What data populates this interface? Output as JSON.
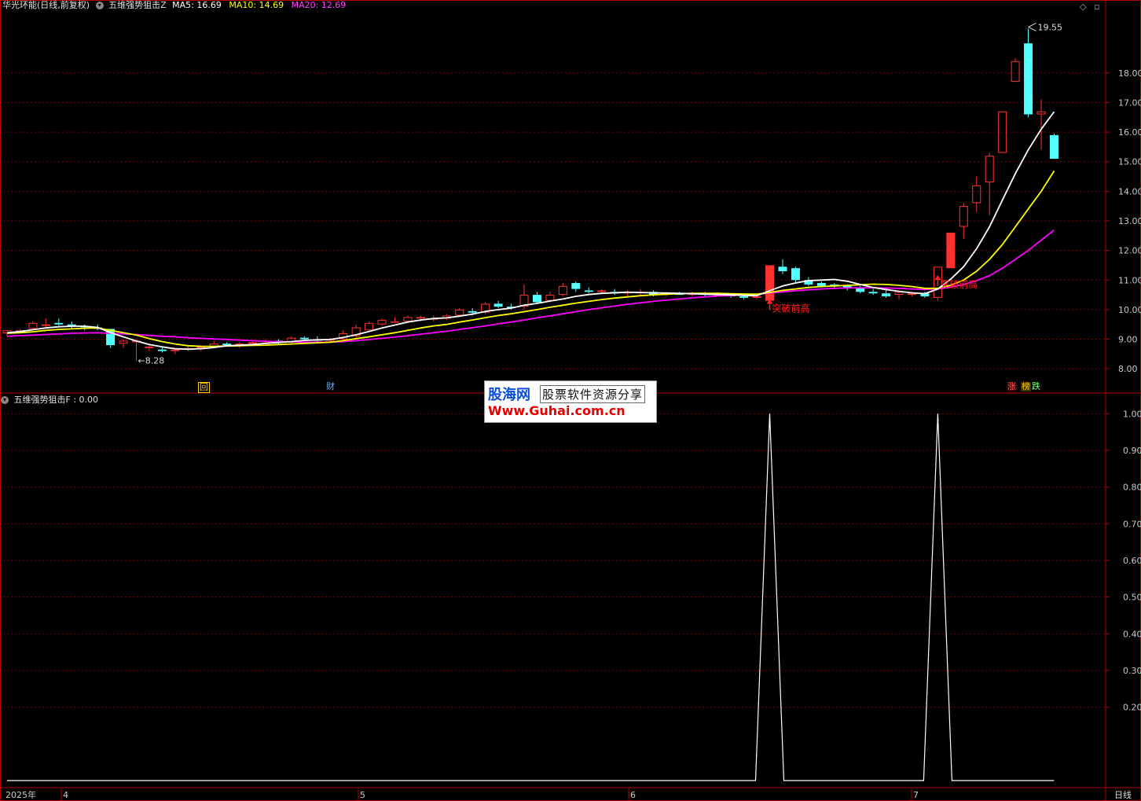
{
  "header": {
    "stock_title": "华光环能(日线,前复权)",
    "indicator_name": "五维强势狙击Z",
    "ma5_label": "MA5: 16.69",
    "ma10_label": "MA10: 14.69",
    "ma20_label": "MA20: 12.69",
    "corner_icons": [
      "diamond-icon",
      "window-icon"
    ]
  },
  "sub_header": {
    "indicator_label": "五维强势狙击F : 0.00"
  },
  "colors": {
    "background": "#000000",
    "grid": "#7a0000",
    "frame": "#b40000",
    "up_candle": "#ff3232",
    "down_candle": "#54ffff",
    "ma5": "#ffffff",
    "ma10": "#ffff00",
    "ma20": "#ff00ff",
    "annotation": "#ff2020",
    "signal_line": "#ffffff"
  },
  "markers": [
    {
      "id": "hui",
      "text": "回",
      "color": "#ffcc00"
    },
    {
      "id": "cai",
      "text": "财",
      "color": "#5fb0ff"
    },
    {
      "id": "zhang",
      "text": "涨",
      "color": "#ff6060"
    },
    {
      "id": "bang",
      "text": "榜",
      "color": "#ffcc00"
    },
    {
      "id": "die",
      "text": "跌",
      "color": "#7cff7c"
    }
  ],
  "watermark": {
    "line1_logo": "股海网",
    "line1_slogan": "股票软件资源分享",
    "line2": "Www.Guhai.com.cn"
  },
  "period_label": "日线",
  "chart_data": [
    {
      "type": "candlestick",
      "panel": "price",
      "ylim": [
        7.5,
        20.2
      ],
      "y_ticks": [
        "18.00",
        "17.00",
        "16.00",
        "15.00",
        "14.00",
        "13.00",
        "12.00",
        "11.00",
        "10.00",
        "9.00",
        "8.00"
      ],
      "x_axis": [
        "2025年",
        "4",
        "5",
        "6",
        "7"
      ],
      "candles": [
        [
          9.2,
          9.3,
          9.1,
          9.3
        ],
        [
          9.25,
          9.35,
          9.2,
          9.3
        ],
        [
          9.35,
          9.6,
          9.3,
          9.55
        ],
        [
          9.45,
          9.7,
          9.4,
          9.5
        ],
        [
          9.55,
          9.7,
          9.45,
          9.5
        ],
        [
          9.5,
          9.6,
          9.35,
          9.45
        ],
        [
          9.45,
          9.5,
          9.3,
          9.4
        ],
        [
          9.4,
          9.5,
          9.3,
          9.35
        ],
        [
          9.35,
          9.35,
          8.7,
          8.8
        ],
        [
          8.85,
          9.0,
          8.7,
          8.95
        ],
        [
          8.9,
          9.0,
          8.28,
          8.95
        ],
        [
          8.7,
          8.8,
          8.6,
          8.75
        ],
        [
          8.65,
          8.75,
          8.55,
          8.6
        ],
        [
          8.6,
          8.7,
          8.5,
          8.65
        ],
        [
          8.65,
          8.75,
          8.6,
          8.7
        ],
        [
          8.7,
          8.8,
          8.6,
          8.75
        ],
        [
          8.75,
          8.95,
          8.7,
          8.85
        ],
        [
          8.85,
          8.9,
          8.75,
          8.8
        ],
        [
          8.8,
          8.9,
          8.7,
          8.85
        ],
        [
          8.85,
          8.95,
          8.8,
          8.9
        ],
        [
          8.9,
          9.0,
          8.85,
          8.95
        ],
        [
          8.95,
          9.0,
          8.85,
          8.9
        ],
        [
          8.9,
          9.1,
          8.85,
          9.05
        ],
        [
          9.05,
          9.1,
          8.95,
          9.0
        ],
        [
          9.0,
          9.1,
          8.9,
          8.95
        ],
        [
          8.95,
          9.05,
          8.9,
          9.0
        ],
        [
          9.0,
          9.3,
          8.95,
          9.2
        ],
        [
          9.1,
          9.5,
          9.0,
          9.4
        ],
        [
          9.3,
          9.6,
          9.25,
          9.55
        ],
        [
          9.5,
          9.7,
          9.45,
          9.65
        ],
        [
          9.6,
          9.75,
          9.55,
          9.6
        ],
        [
          9.6,
          9.8,
          9.55,
          9.75
        ],
        [
          9.7,
          9.8,
          9.6,
          9.75
        ],
        [
          9.7,
          9.8,
          9.6,
          9.7
        ],
        [
          9.7,
          9.85,
          9.65,
          9.8
        ],
        [
          9.8,
          10.05,
          9.75,
          10.0
        ],
        [
          9.95,
          10.05,
          9.8,
          9.9
        ],
        [
          9.9,
          10.25,
          9.85,
          10.2
        ],
        [
          10.2,
          10.3,
          10.05,
          10.1
        ],
        [
          10.1,
          10.2,
          10.0,
          10.05
        ],
        [
          10.1,
          10.85,
          10.0,
          10.5
        ],
        [
          10.5,
          10.6,
          10.2,
          10.25
        ],
        [
          10.3,
          10.6,
          10.25,
          10.5
        ],
        [
          10.5,
          10.9,
          10.45,
          10.8
        ],
        [
          10.9,
          10.95,
          10.6,
          10.7
        ],
        [
          10.65,
          10.75,
          10.55,
          10.6
        ],
        [
          10.6,
          10.7,
          10.55,
          10.65
        ],
        [
          10.6,
          10.7,
          10.5,
          10.55
        ],
        [
          10.55,
          10.65,
          10.45,
          10.6
        ],
        [
          10.55,
          10.7,
          10.5,
          10.6
        ],
        [
          10.6,
          10.65,
          10.45,
          10.5
        ],
        [
          10.5,
          10.6,
          10.45,
          10.55
        ],
        [
          10.55,
          10.6,
          10.5,
          10.5
        ],
        [
          10.5,
          10.6,
          10.45,
          10.55
        ],
        [
          10.55,
          10.6,
          10.45,
          10.5
        ],
        [
          10.5,
          10.6,
          10.45,
          10.5
        ],
        [
          10.5,
          10.55,
          10.4,
          10.45
        ],
        [
          10.45,
          10.5,
          10.35,
          10.4
        ],
        [
          10.4,
          10.5,
          10.35,
          10.45
        ],
        [
          10.3,
          11.5,
          10.25,
          11.5
        ],
        [
          11.45,
          11.7,
          11.2,
          11.3
        ],
        [
          11.4,
          11.45,
          10.9,
          11.0
        ],
        [
          11.0,
          11.1,
          10.8,
          10.85
        ],
        [
          10.9,
          10.95,
          10.75,
          10.8
        ],
        [
          10.85,
          10.9,
          10.7,
          10.8
        ],
        [
          10.8,
          10.85,
          10.65,
          10.75
        ],
        [
          10.75,
          10.8,
          10.55,
          10.6
        ],
        [
          10.6,
          10.7,
          10.5,
          10.55
        ],
        [
          10.55,
          10.7,
          10.4,
          10.45
        ],
        [
          10.5,
          10.65,
          10.35,
          10.6
        ],
        [
          10.5,
          10.6,
          10.45,
          10.55
        ],
        [
          10.55,
          10.6,
          10.4,
          10.45
        ],
        [
          10.4,
          11.45,
          10.3,
          11.45
        ],
        [
          11.4,
          12.6,
          11.4,
          12.6
        ],
        [
          12.8,
          13.6,
          12.4,
          13.5
        ],
        [
          13.6,
          14.5,
          13.3,
          14.2
        ],
        [
          14.3,
          15.3,
          13.2,
          15.2
        ],
        [
          15.3,
          16.7,
          15.3,
          16.7
        ],
        [
          17.7,
          18.5,
          17.7,
          18.4
        ],
        [
          19.0,
          19.5,
          16.5,
          16.6
        ],
        [
          16.6,
          17.1,
          15.4,
          16.7
        ],
        [
          15.9,
          15.95,
          15.1,
          15.1
        ]
      ],
      "ma5": [
        9.22,
        9.26,
        9.32,
        9.38,
        9.42,
        9.44,
        9.44,
        9.4,
        9.22,
        9.08,
        8.94,
        8.82,
        8.74,
        8.68,
        8.66,
        8.68,
        8.72,
        8.78,
        8.8,
        8.82,
        8.86,
        8.89,
        8.92,
        8.96,
        8.98,
        8.99,
        9.06,
        9.15,
        9.26,
        9.38,
        9.48,
        9.58,
        9.65,
        9.7,
        9.72,
        9.78,
        9.85,
        9.94,
        10.0,
        10.05,
        10.15,
        10.21,
        10.29,
        10.36,
        10.45,
        10.51,
        10.55,
        10.57,
        10.59,
        10.58,
        10.57,
        10.56,
        10.55,
        10.54,
        10.52,
        10.51,
        10.5,
        10.48,
        10.47,
        10.64,
        10.8,
        10.9,
        10.98,
        11.0,
        11.02,
        10.96,
        10.85,
        10.75,
        10.68,
        10.62,
        10.57,
        10.54,
        10.7,
        11.03,
        11.45,
        12.06,
        12.8,
        13.7,
        14.6,
        15.4,
        16.1,
        16.69
      ],
      "ma10": [
        9.2,
        9.22,
        9.25,
        9.3,
        9.33,
        9.35,
        9.37,
        9.38,
        9.3,
        9.22,
        9.14,
        9.02,
        8.92,
        8.84,
        8.78,
        8.76,
        8.76,
        8.77,
        8.78,
        8.79,
        8.8,
        8.82,
        8.84,
        8.86,
        8.88,
        8.9,
        8.95,
        9.02,
        9.08,
        9.15,
        9.22,
        9.3,
        9.38,
        9.45,
        9.5,
        9.58,
        9.65,
        9.73,
        9.8,
        9.86,
        9.93,
        10.0,
        10.08,
        10.15,
        10.22,
        10.28,
        10.34,
        10.39,
        10.43,
        10.47,
        10.5,
        10.52,
        10.54,
        10.55,
        10.55,
        10.55,
        10.54,
        10.53,
        10.52,
        10.58,
        10.65,
        10.7,
        10.75,
        10.78,
        10.8,
        10.82,
        10.84,
        10.86,
        10.85,
        10.82,
        10.78,
        10.72,
        10.72,
        10.82,
        11.0,
        11.3,
        11.7,
        12.2,
        12.8,
        13.4,
        14.0,
        14.69
      ],
      "ma20": [
        9.1,
        9.12,
        9.14,
        9.16,
        9.18,
        9.2,
        9.21,
        9.22,
        9.2,
        9.18,
        9.16,
        9.13,
        9.1,
        9.08,
        9.05,
        9.03,
        9.01,
        8.99,
        8.97,
        8.95,
        8.93,
        8.92,
        8.91,
        8.9,
        8.9,
        8.9,
        8.92,
        8.95,
        8.99,
        9.03,
        9.07,
        9.12,
        9.17,
        9.22,
        9.27,
        9.33,
        9.39,
        9.45,
        9.52,
        9.58,
        9.65,
        9.72,
        9.79,
        9.86,
        9.93,
        10.0,
        10.06,
        10.12,
        10.18,
        10.23,
        10.28,
        10.32,
        10.36,
        10.4,
        10.43,
        10.46,
        10.48,
        10.5,
        10.52,
        10.56,
        10.6,
        10.64,
        10.67,
        10.7,
        10.72,
        10.73,
        10.74,
        10.74,
        10.73,
        10.72,
        10.7,
        10.68,
        10.7,
        10.76,
        10.85,
        10.98,
        11.15,
        11.4,
        11.7,
        12.0,
        12.35,
        12.69
      ],
      "annotations": [
        {
          "text": "8.28",
          "candle_index": 10,
          "value": 8.28
        },
        {
          "text": "19.55",
          "candle_index": 79,
          "value": 19.55
        },
        {
          "text": "突破前高",
          "candle_index": 59,
          "value": 10.25
        },
        {
          "text": "突破前高",
          "candle_index": 72,
          "value": 10.9
        }
      ]
    },
    {
      "type": "line",
      "panel": "indicator",
      "title": "五维强势狙击F : 0.00",
      "ylim": [
        0.0,
        1.05
      ],
      "y_ticks": [
        "1.00",
        "0.90",
        "0.80",
        "0.70",
        "0.60",
        "0.50",
        "0.40",
        "0.30",
        "0.20"
      ],
      "signal_indices": [
        59,
        72
      ],
      "series": [
        {
          "values": [
            0,
            0,
            0,
            0,
            0,
            0,
            0,
            0,
            0,
            0,
            0,
            0,
            0,
            0,
            0,
            0,
            0,
            0,
            0,
            0,
            0,
            0,
            0,
            0,
            0,
            0,
            0,
            0,
            0,
            0,
            0,
            0,
            0,
            0,
            0,
            0,
            0,
            0,
            0,
            0,
            0,
            0,
            0,
            0,
            0,
            0,
            0,
            0,
            0,
            0,
            0,
            0,
            0,
            0,
            0,
            0,
            0,
            0,
            0,
            1,
            0,
            0,
            0,
            0,
            0,
            0,
            0,
            0,
            0,
            0,
            0,
            0,
            1,
            0,
            0,
            0,
            0,
            0,
            0,
            0,
            0,
            0
          ]
        }
      ]
    }
  ]
}
